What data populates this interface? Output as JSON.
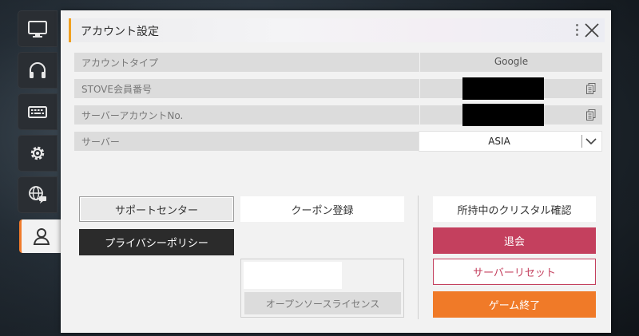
{
  "sidebar": {
    "tabs": [
      {
        "name": "monitor",
        "icon": "monitor-icon"
      },
      {
        "name": "headset",
        "icon": "headset-icon"
      },
      {
        "name": "keyboard",
        "icon": "keyboard-icon"
      },
      {
        "name": "settings",
        "icon": "gear-icon"
      },
      {
        "name": "language",
        "icon": "globe-chat-icon"
      },
      {
        "name": "account",
        "icon": "user-icon",
        "active": true
      }
    ]
  },
  "panel": {
    "title": "アカウント設定",
    "menu_icon": "kebab-icon",
    "close_icon": "close-icon"
  },
  "account": {
    "type_label": "アカウントタイプ",
    "type_value": "Google",
    "stove_label": "STOVE会員番号",
    "server_account_label": "サーバーアカウントNo.",
    "server_label": "サーバー",
    "server_value": "ASIA"
  },
  "buttons": {
    "support": "サポートセンター",
    "privacy": "プライバシーポリシー",
    "coupon": "クーポン登録",
    "crystal": "所持中のクリスタル確認",
    "withdraw": "退会",
    "server_reset": "サーバーリセット",
    "exit": "ゲーム終了",
    "license": "オープンソースライセンス"
  },
  "colors": {
    "accent_orange": "#f07a28",
    "withdraw_red": "#c4405e",
    "title_marker": "#f0a020"
  }
}
